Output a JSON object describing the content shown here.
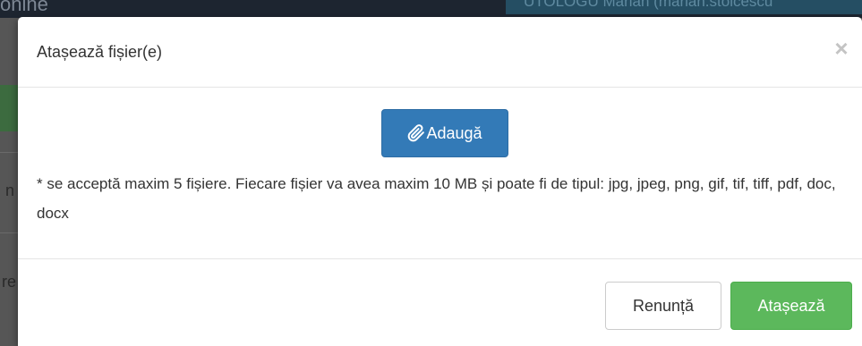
{
  "background": {
    "brand_fragment": "onine",
    "user_fragment": "UTOLOGU Marian (marian.stoicescu",
    "letters": [
      "n",
      "re"
    ]
  },
  "modal": {
    "title": "Atașează fișier(e)",
    "close_glyph": "×",
    "add_button_label": "Adaugă",
    "add_button_icon": "paperclip-icon",
    "info_text": "* se acceptă maxim 5 fișiere. Fiecare fișier va avea maxim 10 MB și poate fi de tipul: jpg, jpeg, png, gif, tif, tiff, pdf, doc, docx",
    "cancel_label": "Renunță",
    "attach_label": "Atașează"
  },
  "colors": {
    "primary": "#337ab7",
    "success": "#5cb85c",
    "text": "#333333"
  }
}
